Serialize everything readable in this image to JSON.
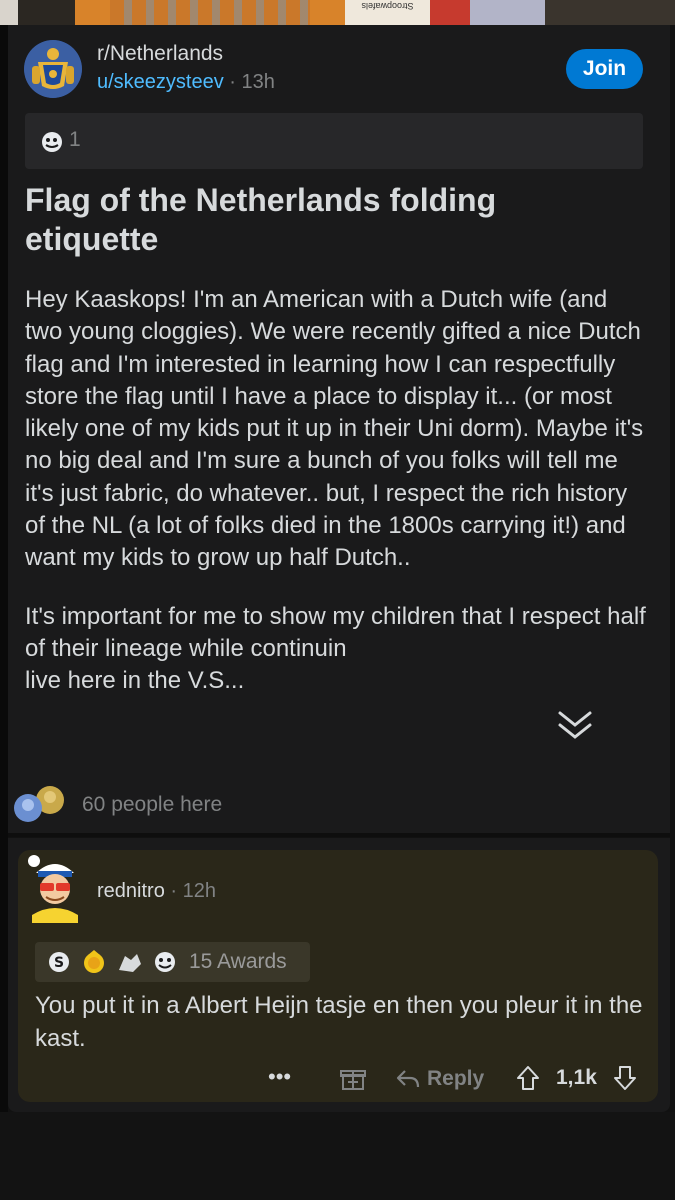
{
  "photo_strip": {
    "label": "Stroopwafels"
  },
  "post": {
    "subreddit": "r/Netherlands",
    "author": "u/skeezysteev",
    "separator": " · ",
    "age": "13h",
    "join_label": "Join",
    "award_count": "1",
    "title": "Flag of the Netherlands folding etiquette",
    "body_paragraph_1": "Hey Kaaskops!  I'm an American with a Dutch wife (and two young cloggies).  We were recently gifted a nice Dutch flag and I'm interested in learning how I can respectfully store the flag until I have a place to display it... (or most likely one of my kids put it up in their Uni dorm).  Maybe it's no big deal and I'm sure a bunch of you folks will tell me it's just fabric, do whatever.. but, I respect the rich history of the NL (a lot of folks died in the 1800s carrying it!) and want my kids to grow up half Dutch..",
    "body_paragraph_2": "It's important for me to show my children that I respect half of their lineage while continuin",
    "body_paragraph_2_end": "live here in the V.S...",
    "presence_text": "60 people here"
  },
  "comment": {
    "author": "rednitro",
    "separator": " · ",
    "age": "12h",
    "awards_label": "15 Awards",
    "text": "You put it in a Albert Heijn tasje en then you pleur it in the kast.",
    "more_label": "•••",
    "reply_label": "Reply",
    "score": "1,1k"
  },
  "colors": {
    "accent": "#0079d3",
    "link": "#4fbcff",
    "card": "#1a1a1b",
    "comment_bg": "#2a2719"
  },
  "icons": [
    "subreddit-crest-icon",
    "award-icon",
    "expand-chevron-icon",
    "presence-avatars-icon",
    "user-avatar-icon",
    "silver-award-icon",
    "gift-icon",
    "reply-arrow-icon",
    "upvote-icon",
    "downvote-icon"
  ]
}
